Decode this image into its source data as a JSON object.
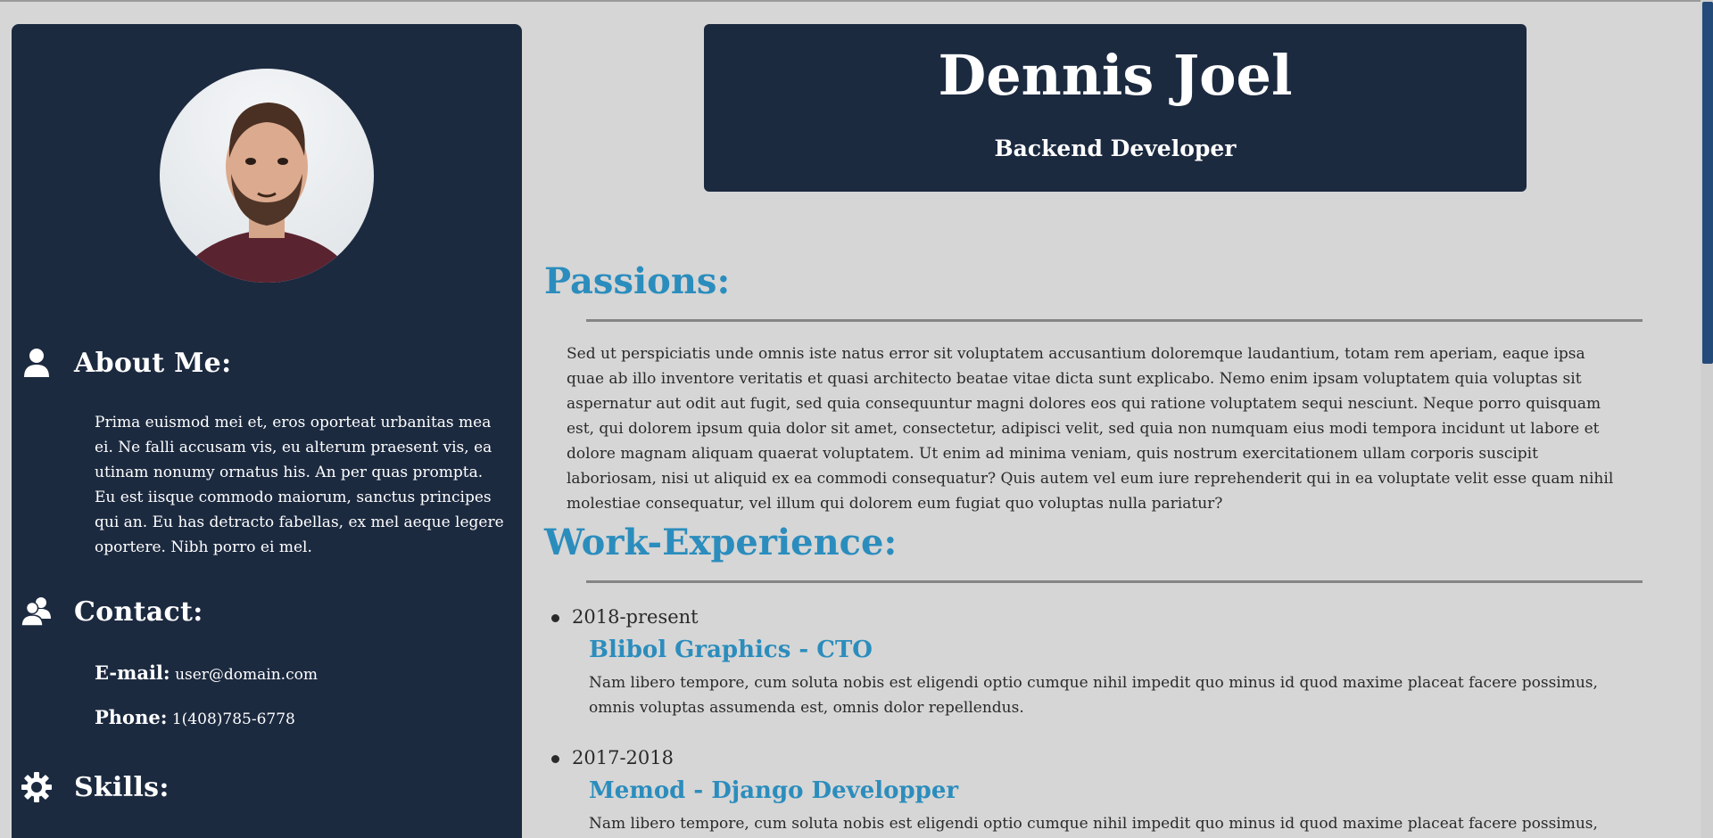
{
  "profile": {
    "name": "Dennis Joel",
    "role": "Backend Developer"
  },
  "sidebar": {
    "about": {
      "heading": "About Me:",
      "icon": "user-icon",
      "text": "Prima euismod mei et, eros oporteat urbanitas mea ei. Ne falli accusam vis, eu alterum praesent vis, ea utinam nonumy ornatus his. An per quas prompta. Eu est iisque commodo maiorum, sanctus principes qui an. Eu has detracto fabellas, ex mel aeque legere oportere. Nibh porro ei mel."
    },
    "contact": {
      "heading": "Contact:",
      "icon": "users-icon",
      "email_label": "E-mail:",
      "email": "user@domain.com",
      "phone_label": "Phone:",
      "phone": "1(408)785-6778"
    },
    "skills": {
      "heading": "Skills:",
      "icon": "gear-icon"
    }
  },
  "main": {
    "passions": {
      "heading": "Passions:",
      "text": "Sed ut perspiciatis unde omnis iste natus error sit voluptatem accusantium doloremque laudantium, totam rem aperiam, eaque ipsa quae ab illo inventore veritatis et quasi architecto beatae vitae dicta sunt explicabo. Nemo enim ipsam voluptatem quia voluptas sit aspernatur aut odit aut fugit, sed quia consequuntur magni dolores eos qui ratione voluptatem sequi nesciunt. Neque porro quisquam est, qui dolorem ipsum quia dolor sit amet, consectetur, adipisci velit, sed quia non numquam eius modi tempora incidunt ut labore et dolore magnam aliquam quaerat voluptatem. Ut enim ad minima veniam, quis nostrum exercitationem ullam corporis suscipit laboriosam, nisi ut aliquid ex ea commodi consequatur? Quis autem vel eum iure reprehenderit qui in ea voluptate velit esse quam nihil molestiae consequatur, vel illum qui dolorem eum fugiat quo voluptas nulla pariatur?"
    },
    "work": {
      "heading": "Work-Experience:",
      "jobs": [
        {
          "dates": "2018-present",
          "title": "Blibol Graphics - CTO",
          "desc": "Nam libero tempore, cum soluta nobis est eligendi optio cumque nihil impedit quo minus id quod maxime placeat facere possimus, omnis voluptas assumenda est, omnis dolor repellendus."
        },
        {
          "dates": "2017-2018",
          "title": "Memod - Django Developper",
          "desc": "Nam libero tempore, cum soluta nobis est eligendi optio cumque nihil impedit quo minus id quod maxime placeat facere possimus, omnis voluptas"
        }
      ]
    }
  },
  "colors": {
    "panel": "#1c2a40",
    "accent": "#2b8dbd",
    "page": "#d6d6d6"
  }
}
